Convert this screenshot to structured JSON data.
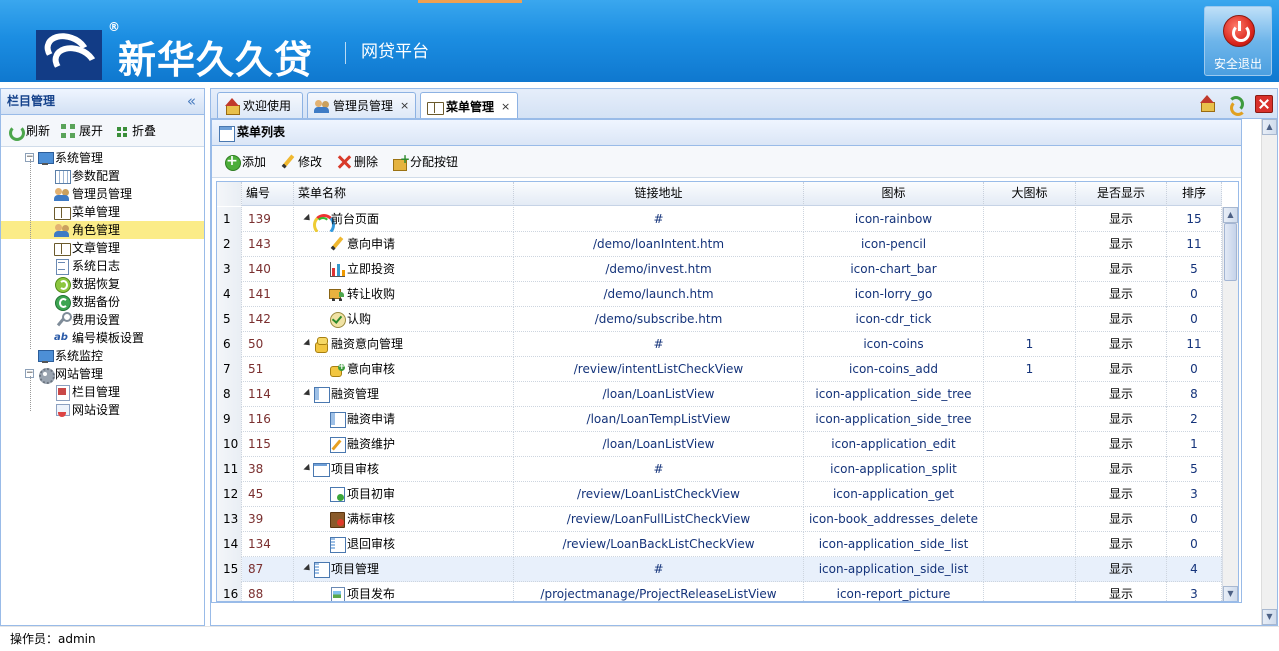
{
  "header": {
    "logo_text": "新华久久贷",
    "registered_mark": "®",
    "subtitle": "网贷平台",
    "logout_label": "安全退出"
  },
  "sidebar": {
    "title": "栏目管理",
    "collapse_glyph": "«",
    "toolbar": {
      "refresh": "刷新",
      "expand": "展开",
      "collapse": "折叠"
    },
    "tree": [
      {
        "label": "系统管理",
        "level": 0,
        "icon": "monitor-icon",
        "expanded": true
      },
      {
        "label": "参数配置",
        "level": 1,
        "icon": "grid-icon"
      },
      {
        "label": "管理员管理",
        "level": 1,
        "icon": "users-icon"
      },
      {
        "label": "菜单管理",
        "level": 1,
        "icon": "book-icon"
      },
      {
        "label": "角色管理",
        "level": 1,
        "icon": "users-icon",
        "selected": true
      },
      {
        "label": "文章管理",
        "level": 1,
        "icon": "book-icon"
      },
      {
        "label": "系统日志",
        "level": 1,
        "icon": "log-file-icon"
      },
      {
        "label": "数据恢复",
        "level": 1,
        "icon": "restore-icon"
      },
      {
        "label": "数据备份",
        "level": 1,
        "icon": "backup-icon"
      },
      {
        "label": "费用设置",
        "level": 1,
        "icon": "wrench-icon"
      },
      {
        "label": "编号模板设置",
        "level": 1,
        "icon": "ab-icon"
      },
      {
        "label": "系统监控",
        "level": 0,
        "icon": "monitor-icon"
      },
      {
        "label": "网站管理",
        "level": 0,
        "icon": "gear-icon",
        "expanded": true
      },
      {
        "label": "栏目管理",
        "level": 1,
        "icon": "sitemap-icon"
      },
      {
        "label": "网站设置",
        "level": 1,
        "icon": "site-settings-icon"
      }
    ]
  },
  "tabs": [
    {
      "label": "欢迎使用",
      "icon": "home-icon",
      "closable": false
    },
    {
      "label": "管理员管理",
      "icon": "users-icon",
      "closable": true
    },
    {
      "label": "菜单管理",
      "icon": "book-icon",
      "closable": true,
      "active": true
    }
  ],
  "tab_close_glyph": "×",
  "panel": {
    "title": "菜单列表",
    "toolbar": {
      "add": "添加",
      "edit": "修改",
      "delete": "删除",
      "assign": "分配按钮"
    }
  },
  "grid": {
    "columns": [
      "编号",
      "菜单名称",
      "链接地址",
      "图标",
      "大图标",
      "是否显示",
      "排序"
    ],
    "rows": [
      {
        "no": "1",
        "id": "139",
        "name": "前台页面",
        "level": 0,
        "has_children": true,
        "icon": "rainbow-icon",
        "url": "#",
        "icon_cls": "icon-rainbow",
        "big_icon": "",
        "show": "显示",
        "sort": "15"
      },
      {
        "no": "2",
        "id": "143",
        "name": "意向申请",
        "level": 1,
        "icon": "pencil-icon",
        "url": "/demo/loanIntent.htm",
        "icon_cls": "icon-pencil",
        "big_icon": "",
        "show": "显示",
        "sort": "11"
      },
      {
        "no": "3",
        "id": "140",
        "name": "立即投资",
        "level": 1,
        "icon": "chart-bar-icon",
        "url": "/demo/invest.htm",
        "icon_cls": "icon-chart_bar",
        "big_icon": "",
        "show": "显示",
        "sort": "5"
      },
      {
        "no": "4",
        "id": "141",
        "name": "转让收购",
        "level": 1,
        "icon": "lorry-icon",
        "url": "/demo/launch.htm",
        "icon_cls": "icon-lorry_go",
        "big_icon": "",
        "show": "显示",
        "sort": "0"
      },
      {
        "no": "5",
        "id": "142",
        "name": "认购",
        "level": 1,
        "icon": "tick-icon",
        "url": "/demo/subscribe.htm",
        "icon_cls": "icon-cdr_tick",
        "big_icon": "",
        "show": "显示",
        "sort": "0"
      },
      {
        "no": "6",
        "id": "50",
        "name": "融资意向管理",
        "level": 0,
        "has_children": true,
        "icon": "coins-icon",
        "url": "#",
        "icon_cls": "icon-coins",
        "big_icon": "1",
        "show": "显示",
        "sort": "11"
      },
      {
        "no": "7",
        "id": "51",
        "name": "意向审核",
        "level": 1,
        "icon": "coins-add-icon",
        "url": "/review/intentListCheckView",
        "icon_cls": "icon-coins_add",
        "big_icon": "1",
        "show": "显示",
        "sort": "0"
      },
      {
        "no": "8",
        "id": "114",
        "name": "融资管理",
        "level": 0,
        "has_children": true,
        "icon": "side-tree-icon",
        "url": "/loan/LoanListView",
        "icon_cls": "icon-application_side_tree",
        "big_icon": "",
        "show": "显示",
        "sort": "8"
      },
      {
        "no": "9",
        "id": "116",
        "name": "融资申请",
        "level": 1,
        "icon": "side-tree-icon",
        "url": "/loan/LoanTempListView",
        "icon_cls": "icon-application_side_tree",
        "big_icon": "",
        "show": "显示",
        "sort": "2"
      },
      {
        "no": "10",
        "id": "115",
        "name": "融资维护",
        "level": 1,
        "icon": "app-edit-icon",
        "url": "/loan/LoanListView",
        "icon_cls": "icon-application_edit",
        "big_icon": "",
        "show": "显示",
        "sort": "1"
      },
      {
        "no": "11",
        "id": "38",
        "name": "项目审核",
        "level": 0,
        "has_children": true,
        "icon": "split-icon",
        "url": "#",
        "icon_cls": "icon-application_split",
        "big_icon": "",
        "show": "显示",
        "sort": "5"
      },
      {
        "no": "12",
        "id": "45",
        "name": "项目初审",
        "level": 1,
        "icon": "app-get-icon",
        "url": "/review/LoanListCheckView",
        "icon_cls": "icon-application_get",
        "big_icon": "",
        "show": "显示",
        "sort": "3"
      },
      {
        "no": "13",
        "id": "39",
        "name": "满标审核",
        "level": 1,
        "icon": "book-delete-icon",
        "url": "/review/LoanFullListCheckView",
        "icon_cls": "icon-book_addresses_delete",
        "big_icon": "",
        "show": "显示",
        "sort": "0"
      },
      {
        "no": "14",
        "id": "134",
        "name": "退回审核",
        "level": 1,
        "icon": "side-list-icon",
        "url": "/review/LoanBackListCheckView",
        "icon_cls": "icon-application_side_list",
        "big_icon": "",
        "show": "显示",
        "sort": "0"
      },
      {
        "no": "15",
        "id": "87",
        "name": "项目管理",
        "level": 0,
        "has_children": true,
        "icon": "side-list-icon",
        "url": "#",
        "icon_cls": "icon-application_side_list",
        "big_icon": "",
        "show": "显示",
        "sort": "4",
        "hover": true
      },
      {
        "no": "16",
        "id": "88",
        "name": "项目发布",
        "level": 1,
        "icon": "report-picture-icon",
        "url": "/projectmanage/ProjectReleaseListView",
        "icon_cls": "icon-report_picture",
        "big_icon": "",
        "show": "显示",
        "sort": "3"
      }
    ]
  },
  "footer": {
    "operator_label": "操作员：",
    "operator_name": "admin"
  },
  "colors": {
    "header_blue": "#1c8ee2",
    "panel_border": "#99bbe8",
    "selected_tree": "#fbec88",
    "id_text": "#7a2f2f"
  }
}
